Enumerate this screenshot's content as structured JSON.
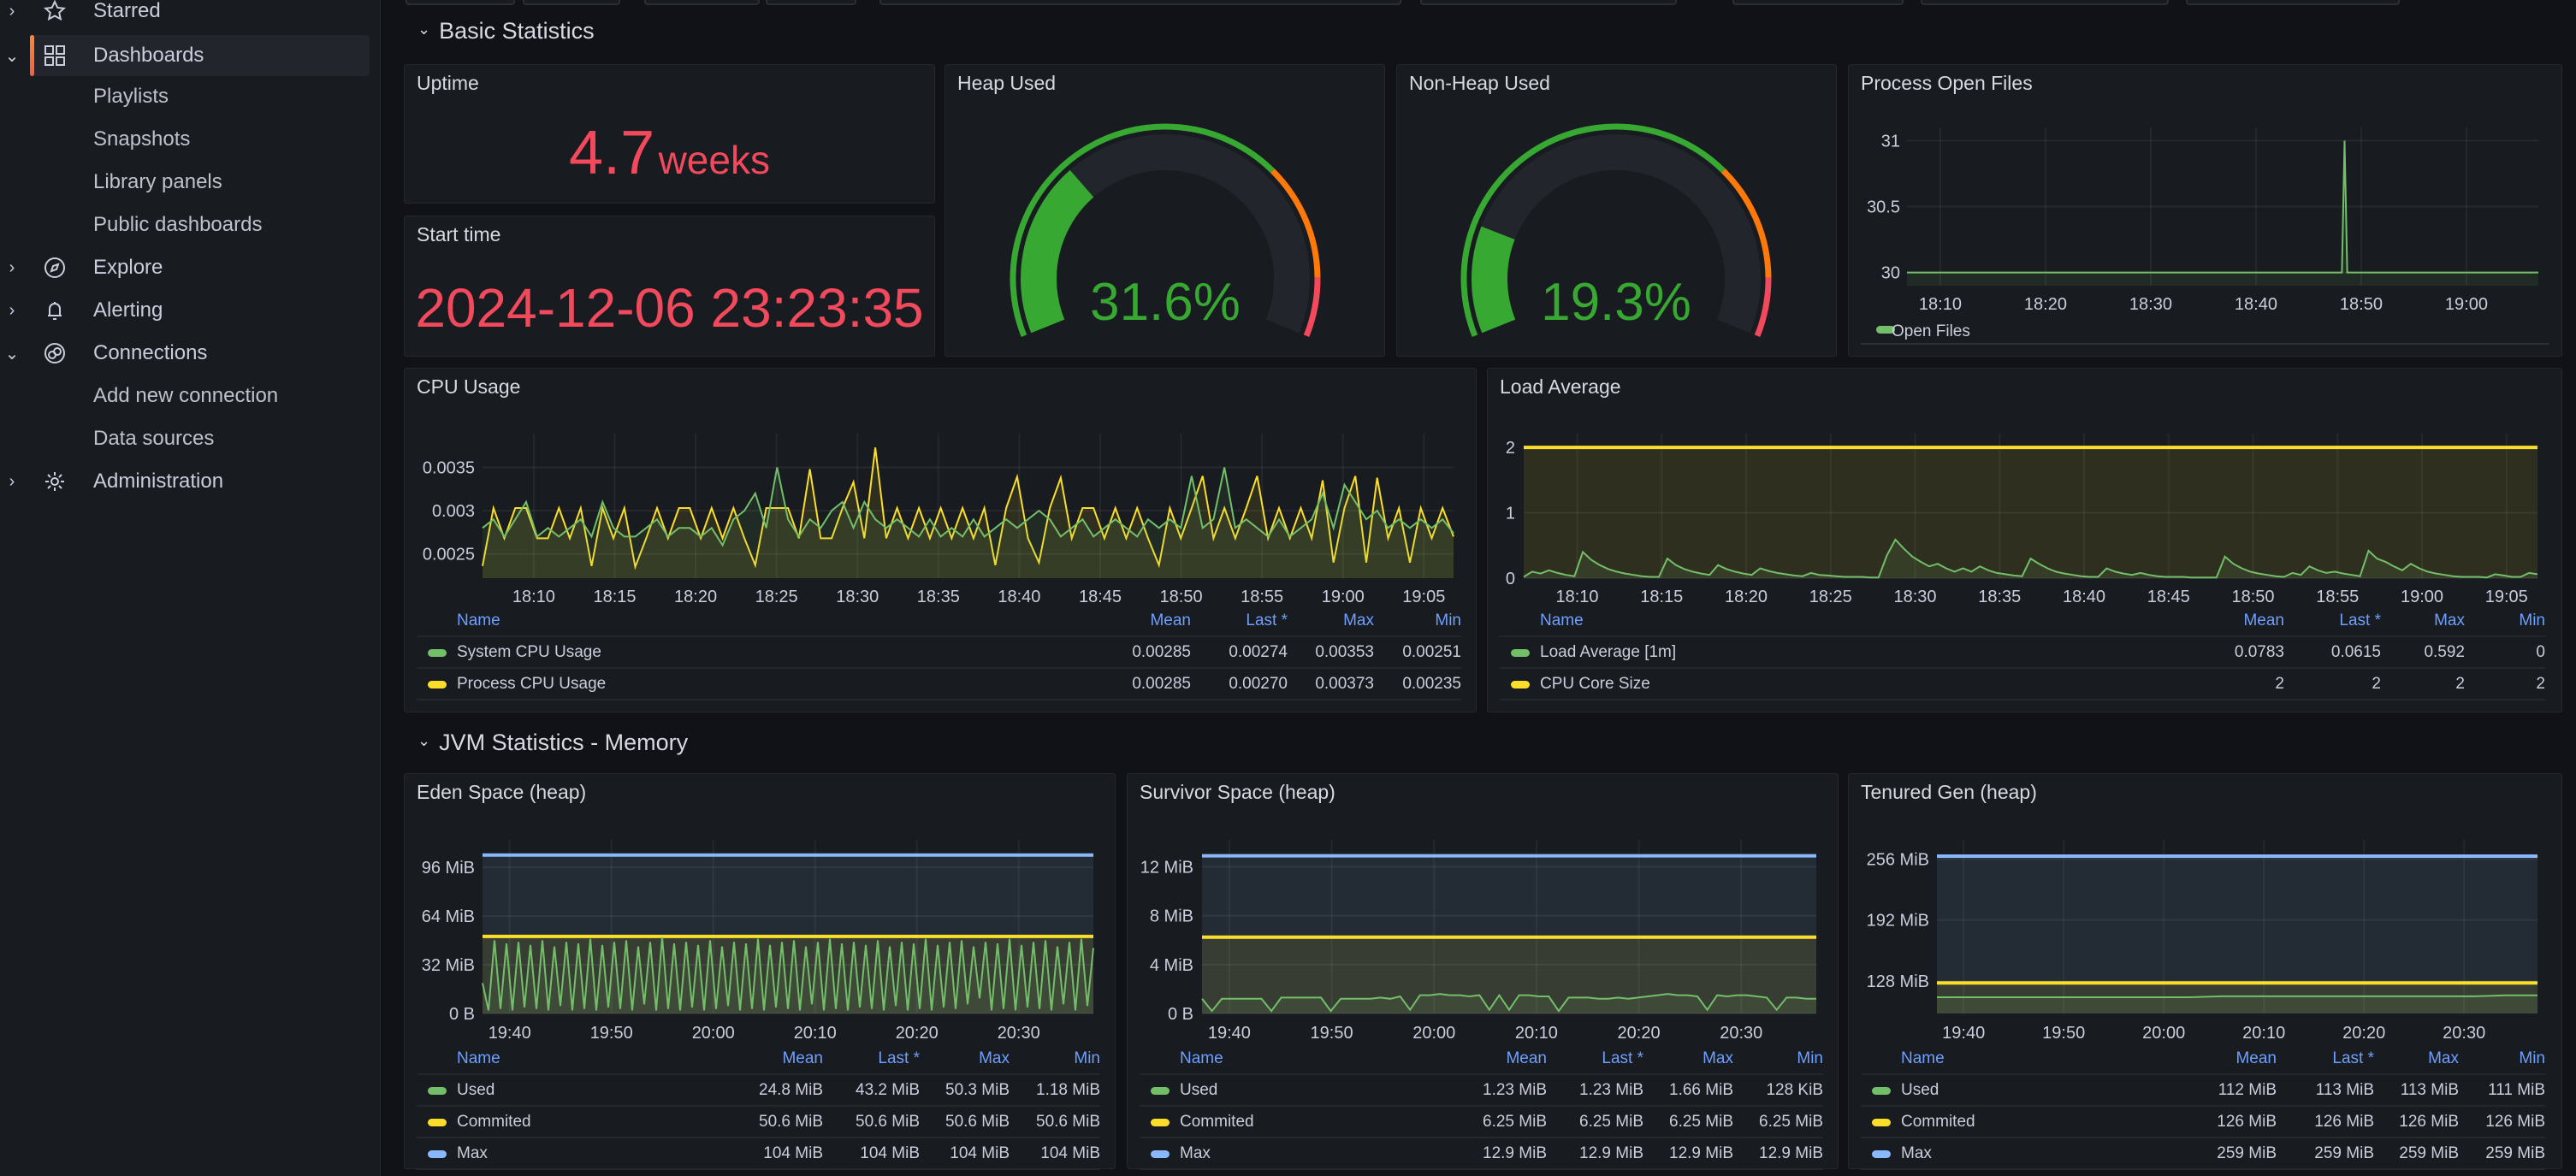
{
  "colors": {
    "green": "#73bf69",
    "yellow": "#fade2a",
    "blue": "#8ab8ff",
    "red": "#f2495c",
    "orange": "#ff780a",
    "gauge_green": "#37a831",
    "accent": "#f55f3e",
    "legend_header": "#6e9fff"
  },
  "sidebar": {
    "items": [
      {
        "label": "Starred",
        "icon": "star-icon",
        "chevron": "›"
      },
      {
        "label": "Dashboards",
        "icon": "dashboards-grid-icon",
        "chevron": "⌄",
        "active": true
      },
      {
        "label": "Playlists"
      },
      {
        "label": "Snapshots"
      },
      {
        "label": "Library panels"
      },
      {
        "label": "Public dashboards"
      },
      {
        "label": "Explore",
        "icon": "compass-icon",
        "chevron": "›"
      },
      {
        "label": "Alerting",
        "icon": "bell-icon",
        "chevron": "›"
      },
      {
        "label": "Connections",
        "icon": "connections-icon",
        "chevron": "⌄"
      },
      {
        "label": "Add new connection"
      },
      {
        "label": "Data sources"
      },
      {
        "label": "Administration",
        "icon": "gear-icon",
        "chevron": "›"
      }
    ]
  },
  "rows": [
    {
      "title": "Basic Statistics",
      "chevron": "⌄"
    },
    {
      "title": "JVM Statistics - Memory",
      "chevron": "⌄"
    }
  ],
  "panels": {
    "uptime": {
      "title": "Uptime",
      "value": "4.7",
      "unit": "weeks"
    },
    "start_time": {
      "title": "Start time",
      "value": "2024-12-06 23:23:35"
    },
    "heap": {
      "title": "Heap Used",
      "value": 31.6,
      "display": "31.6%",
      "min": 0,
      "max": 100,
      "thresholds": [
        {
          "from": 0,
          "color": "#37a831"
        },
        {
          "from": 70,
          "color": "#ff780a"
        },
        {
          "from": 90,
          "color": "#f2495c"
        }
      ]
    },
    "nonheap": {
      "title": "Non-Heap Used",
      "value": 19.3,
      "display": "19.3%",
      "min": 0,
      "max": 100,
      "thresholds": [
        {
          "from": 0,
          "color": "#37a831"
        },
        {
          "from": 70,
          "color": "#ff780a"
        },
        {
          "from": 90,
          "color": "#f2495c"
        }
      ]
    },
    "open_files": {
      "title": "Process Open Files",
      "legend": "Open Files"
    },
    "cpu": {
      "title": "CPU Usage"
    },
    "load": {
      "title": "Load Average"
    },
    "eden": {
      "title": "Eden Space (heap)"
    },
    "survivor": {
      "title": "Survivor Space (heap)"
    },
    "tenured": {
      "title": "Tenured Gen (heap)"
    }
  },
  "legend_columns": [
    "Name",
    "Mean",
    "Last *",
    "Max",
    "Min"
  ],
  "chart_data": {
    "open_files": {
      "type": "line",
      "x_range": [
        "18:06:50",
        "19:06:50"
      ],
      "y_range": [
        29.9,
        31.1
      ],
      "x_ticks": [
        "18:10",
        "18:20",
        "18:30",
        "18:40",
        "18:50",
        "19:00"
      ],
      "y_ticks": [
        {
          "v": 30,
          "l": "30"
        },
        {
          "v": 30.5,
          "l": "30.5"
        },
        {
          "v": 31,
          "l": "31"
        }
      ],
      "series": [
        {
          "name": "Open Files",
          "color": "#73bf69",
          "points": [
            [
              "18:06:50",
              30
            ],
            [
              "18:48:10",
              30
            ],
            [
              "18:48:25",
              31
            ],
            [
              "18:48:40",
              30
            ],
            [
              "19:06:50",
              30
            ]
          ]
        }
      ]
    },
    "cpu": {
      "type": "line",
      "x_range": [
        "18:06:50",
        "19:06:50"
      ],
      "y_range": [
        0.00222,
        0.00389
      ],
      "x_ticks": [
        "18:10",
        "18:15",
        "18:20",
        "18:25",
        "18:30",
        "18:35",
        "18:40",
        "18:45",
        "18:50",
        "18:55",
        "19:00",
        "19:05"
      ],
      "y_ticks": [
        {
          "v": 0.0025,
          "l": "0.0025"
        },
        {
          "v": 0.003,
          "l": "0.003"
        },
        {
          "v": 0.0035,
          "l": "0.0035"
        }
      ],
      "series": [
        {
          "name": "System CPU Usage",
          "color": "#73bf69",
          "stats": [
            "0.00285",
            "0.00274",
            "0.00353",
            "0.00251"
          ],
          "values": [
            0.0028,
            0.0029,
            0.0027,
            0.0029,
            0.0031,
            0.0027,
            0.0028,
            0.0027,
            0.0028,
            0.0029,
            0.0027,
            0.0031,
            0.0028,
            0.0027,
            0.0027,
            0.0028,
            0.0029,
            0.0027,
            0.0028,
            0.0028,
            0.0027,
            0.0028,
            0.0026,
            0.0029,
            0.003,
            0.0032,
            0.0028,
            0.0035,
            0.0029,
            0.0027,
            0.0029,
            0.0028,
            0.003,
            0.0031,
            0.0028,
            0.0031,
            0.0029,
            0.0028,
            0.0029,
            0.0028,
            0.0027,
            0.0029,
            0.0027,
            0.0028,
            0.0027,
            0.0029,
            0.0027,
            0.0028,
            0.0029,
            0.0028,
            0.0029,
            0.003,
            0.0029,
            0.0027,
            0.0028,
            0.0029,
            0.0027,
            0.0028,
            0.0029,
            0.0028,
            0.0027,
            0.0029,
            0.0028,
            0.0029,
            0.0028,
            0.0034,
            0.0028,
            0.0029,
            0.0035,
            0.0028,
            0.0029,
            0.0028,
            0.0027,
            0.0029,
            0.0027,
            0.0028,
            0.0029,
            0.0032,
            0.0028,
            0.0033,
            0.0031,
            0.0029,
            0.003,
            0.0028,
            0.0029,
            0.0028,
            0.0029,
            0.0028,
            0.0029,
            0.00274
          ]
        },
        {
          "name": "Process CPU Usage",
          "color": "#fade2a",
          "stats": [
            "0.00285",
            "0.00270",
            "0.00373",
            "0.00235"
          ],
          "values": [
            0.00236,
            0.00303,
            0.00268,
            0.00303,
            0.00303,
            0.00268,
            0.00268,
            0.00303,
            0.00268,
            0.00303,
            0.00236,
            0.00303,
            0.00268,
            0.00303,
            0.00235,
            0.00268,
            0.00303,
            0.00268,
            0.00303,
            0.00303,
            0.00268,
            0.00303,
            0.00268,
            0.00303,
            0.00268,
            0.00237,
            0.00303,
            0.00303,
            0.00303,
            0.00268,
            0.00348,
            0.00268,
            0.00268,
            0.00303,
            0.00333,
            0.00268,
            0.00373,
            0.00268,
            0.00303,
            0.00268,
            0.00303,
            0.00268,
            0.00303,
            0.00268,
            0.00303,
            0.00268,
            0.00303,
            0.00237,
            0.00303,
            0.00339,
            0.00268,
            0.0024,
            0.00303,
            0.00338,
            0.00268,
            0.00303,
            0.00303,
            0.00268,
            0.00303,
            0.00268,
            0.00303,
            0.00268,
            0.00237,
            0.00303,
            0.00268,
            0.00303,
            0.0034,
            0.00268,
            0.00303,
            0.00268,
            0.00303,
            0.0034,
            0.00268,
            0.00303,
            0.00268,
            0.00303,
            0.00268,
            0.00335,
            0.0024,
            0.00303,
            0.0034,
            0.0024,
            0.00338,
            0.00268,
            0.00303,
            0.0024,
            0.00303,
            0.00268,
            0.00303,
            0.0027
          ]
        }
      ]
    },
    "load": {
      "type": "line",
      "x_range": [
        "18:06:50",
        "19:06:50"
      ],
      "y_range": [
        0,
        2.21
      ],
      "x_ticks": [
        "18:10",
        "18:15",
        "18:20",
        "18:25",
        "18:30",
        "18:35",
        "18:40",
        "18:45",
        "18:50",
        "18:55",
        "19:00",
        "19:05"
      ],
      "y_ticks": [
        {
          "v": 0,
          "l": "0"
        },
        {
          "v": 1,
          "l": "1"
        },
        {
          "v": 2,
          "l": "2"
        }
      ],
      "series": [
        {
          "name": "Load Average [1m]",
          "color": "#73bf69",
          "stats": [
            "0.0783",
            "0.0615",
            "0.592",
            "0"
          ],
          "values": [
            0.02,
            0.1,
            0.07,
            0.12,
            0.08,
            0.05,
            0.03,
            0.4,
            0.28,
            0.2,
            0.14,
            0.1,
            0.07,
            0.05,
            0.03,
            0.02,
            0.02,
            0.3,
            0.2,
            0.14,
            0.1,
            0.07,
            0.05,
            0.2,
            0.14,
            0.1,
            0.07,
            0.05,
            0.15,
            0.11,
            0.08,
            0.06,
            0.04,
            0.03,
            0.08,
            0.05,
            0.04,
            0.03,
            0.02,
            0.02,
            0.02,
            0.01,
            0.01,
            0.35,
            0.59,
            0.45,
            0.33,
            0.25,
            0.18,
            0.22,
            0.15,
            0.1,
            0.15,
            0.1,
            0.18,
            0.12,
            0.08,
            0.06,
            0.04,
            0.03,
            0.3,
            0.22,
            0.15,
            0.1,
            0.07,
            0.05,
            0.03,
            0.02,
            0.02,
            0.15,
            0.1,
            0.07,
            0.05,
            0.08,
            0.05,
            0.03,
            0.02,
            0.02,
            0.02,
            0.01,
            0.01,
            0.01,
            0.01,
            0.33,
            0.22,
            0.15,
            0.1,
            0.07,
            0.05,
            0.03,
            0.02,
            0.08,
            0.05,
            0.18,
            0.12,
            0.08,
            0.1,
            0.07,
            0.05,
            0.03,
            0.42,
            0.3,
            0.25,
            0.18,
            0.12,
            0.22,
            0.15,
            0.1,
            0.07,
            0.05,
            0.03,
            0.02,
            0.02,
            0.02,
            0.01,
            0.06,
            0.04,
            0.02,
            0.02,
            0.08,
            0.06
          ]
        },
        {
          "name": "CPU Core Size",
          "color": "#fade2a",
          "stats": [
            "2",
            "2",
            "2",
            "2"
          ],
          "values": [
            2,
            2
          ]
        }
      ]
    },
    "eden": {
      "type": "line",
      "x_range": [
        "19:37:20",
        "20:37:20"
      ],
      "y_range": [
        0,
        114
      ],
      "x_ticks": [
        "19:40",
        "19:50",
        "20:00",
        "20:10",
        "20:20",
        "20:30"
      ],
      "y_ticks": [
        {
          "v": 0,
          "l": "0 B"
        },
        {
          "v": 32,
          "l": "32 MiB"
        },
        {
          "v": 64,
          "l": "64 MiB"
        },
        {
          "v": 96,
          "l": "96 MiB"
        }
      ],
      "series": [
        {
          "name": "Used",
          "color": "#73bf69",
          "stats": [
            "24.8 MiB",
            "43.2 MiB",
            "50.3 MiB",
            "1.18 MiB"
          ],
          "values": [
            20,
            2,
            48,
            3,
            46,
            2,
            47,
            4,
            45,
            3,
            48,
            2,
            44,
            5,
            47,
            2,
            46,
            3,
            49,
            2,
            45,
            4,
            47,
            3,
            48,
            2,
            44,
            6,
            47,
            2,
            50,
            3,
            46,
            2,
            47,
            4,
            45,
            2,
            48,
            3,
            44,
            5,
            47,
            2,
            46,
            3,
            49,
            2,
            45,
            4,
            47,
            3,
            48,
            2,
            44,
            6,
            47,
            2,
            49,
            3,
            46,
            2,
            47,
            4,
            45,
            3,
            48,
            2,
            44,
            5,
            47,
            2,
            46,
            3,
            49,
            2,
            45,
            4,
            47,
            3,
            48,
            6,
            44,
            10,
            47,
            2,
            46,
            3,
            49,
            2,
            45,
            4,
            47,
            3,
            48,
            2,
            44,
            6,
            47,
            2,
            49,
            5,
            43
          ]
        },
        {
          "name": "Commited",
          "color": "#fade2a",
          "stats": [
            "50.6 MiB",
            "50.6 MiB",
            "50.6 MiB",
            "50.6 MiB"
          ],
          "values": [
            50.6,
            50.6
          ]
        },
        {
          "name": "Max",
          "color": "#8ab8ff",
          "stats": [
            "104 MiB",
            "104 MiB",
            "104 MiB",
            "104 MiB"
          ],
          "values": [
            104,
            104
          ]
        }
      ]
    },
    "survivor": {
      "type": "line",
      "x_range": [
        "19:37:20",
        "20:37:20"
      ],
      "y_range": [
        0,
        14.2
      ],
      "x_ticks": [
        "19:40",
        "19:50",
        "20:00",
        "20:10",
        "20:20",
        "20:30"
      ],
      "y_ticks": [
        {
          "v": 0,
          "l": "0 B"
        },
        {
          "v": 4,
          "l": "4 MiB"
        },
        {
          "v": 8,
          "l": "8 MiB"
        },
        {
          "v": 12,
          "l": "12 MiB"
        }
      ],
      "series": [
        {
          "name": "Used",
          "color": "#73bf69",
          "stats": [
            "1.23 MiB",
            "1.23 MiB",
            "1.66 MiB",
            "128 KiB"
          ],
          "values": [
            1.2,
            0.2,
            1.2,
            1.2,
            1.2,
            1.2,
            1.2,
            0.2,
            1.3,
            1.3,
            1.3,
            1.3,
            1.3,
            0.2,
            1.2,
            1.2,
            1.2,
            1.2,
            1.3,
            1.2,
            1.4,
            0.3,
            1.5,
            1.5,
            1.6,
            1.5,
            1.5,
            1.4,
            1.5,
            0.3,
            1.5,
            0.3,
            1.5,
            1.5,
            1.4,
            1.4,
            0.2,
            1.3,
            1.3,
            1.3,
            1.2,
            1.2,
            1.3,
            1.2,
            1.3,
            1.4,
            1.5,
            1.6,
            1.5,
            1.5,
            1.4,
            0.3,
            1.5,
            1.4,
            1.5,
            1.5,
            1.4,
            1.3,
            0.3,
            1.3,
            1.3,
            1.2,
            1.2
          ]
        },
        {
          "name": "Commited",
          "color": "#fade2a",
          "stats": [
            "6.25 MiB",
            "6.25 MiB",
            "6.25 MiB",
            "6.25 MiB"
          ],
          "values": [
            6.25,
            6.25
          ]
        },
        {
          "name": "Max",
          "color": "#8ab8ff",
          "stats": [
            "12.9 MiB",
            "12.9 MiB",
            "12.9 MiB",
            "12.9 MiB"
          ],
          "values": [
            12.9,
            12.9
          ]
        }
      ]
    },
    "tenured": {
      "type": "line",
      "x_range": [
        "19:37:20",
        "20:37:20"
      ],
      "y_range": [
        94,
        276
      ],
      "x_ticks": [
        "19:40",
        "19:50",
        "20:00",
        "20:10",
        "20:20",
        "20:30"
      ],
      "y_ticks": [
        {
          "v": 128,
          "l": "128 MiB"
        },
        {
          "v": 192,
          "l": "192 MiB"
        },
        {
          "v": 256,
          "l": "256 MiB"
        }
      ],
      "series": [
        {
          "name": "Used",
          "color": "#73bf69",
          "stats": [
            "112 MiB",
            "113 MiB",
            "113 MiB",
            "111 MiB"
          ],
          "values": [
            111,
            111,
            111,
            111,
            111,
            111,
            111,
            111,
            111,
            112,
            112,
            112,
            112,
            112,
            112,
            112,
            112,
            112,
            113,
            113
          ]
        },
        {
          "name": "Commited",
          "color": "#fade2a",
          "stats": [
            "126 MiB",
            "126 MiB",
            "126 MiB",
            "126 MiB"
          ],
          "values": [
            126,
            126
          ]
        },
        {
          "name": "Max",
          "color": "#8ab8ff",
          "stats": [
            "259 MiB",
            "259 MiB",
            "259 MiB",
            "259 MiB"
          ],
          "values": [
            259,
            259
          ]
        }
      ]
    }
  }
}
